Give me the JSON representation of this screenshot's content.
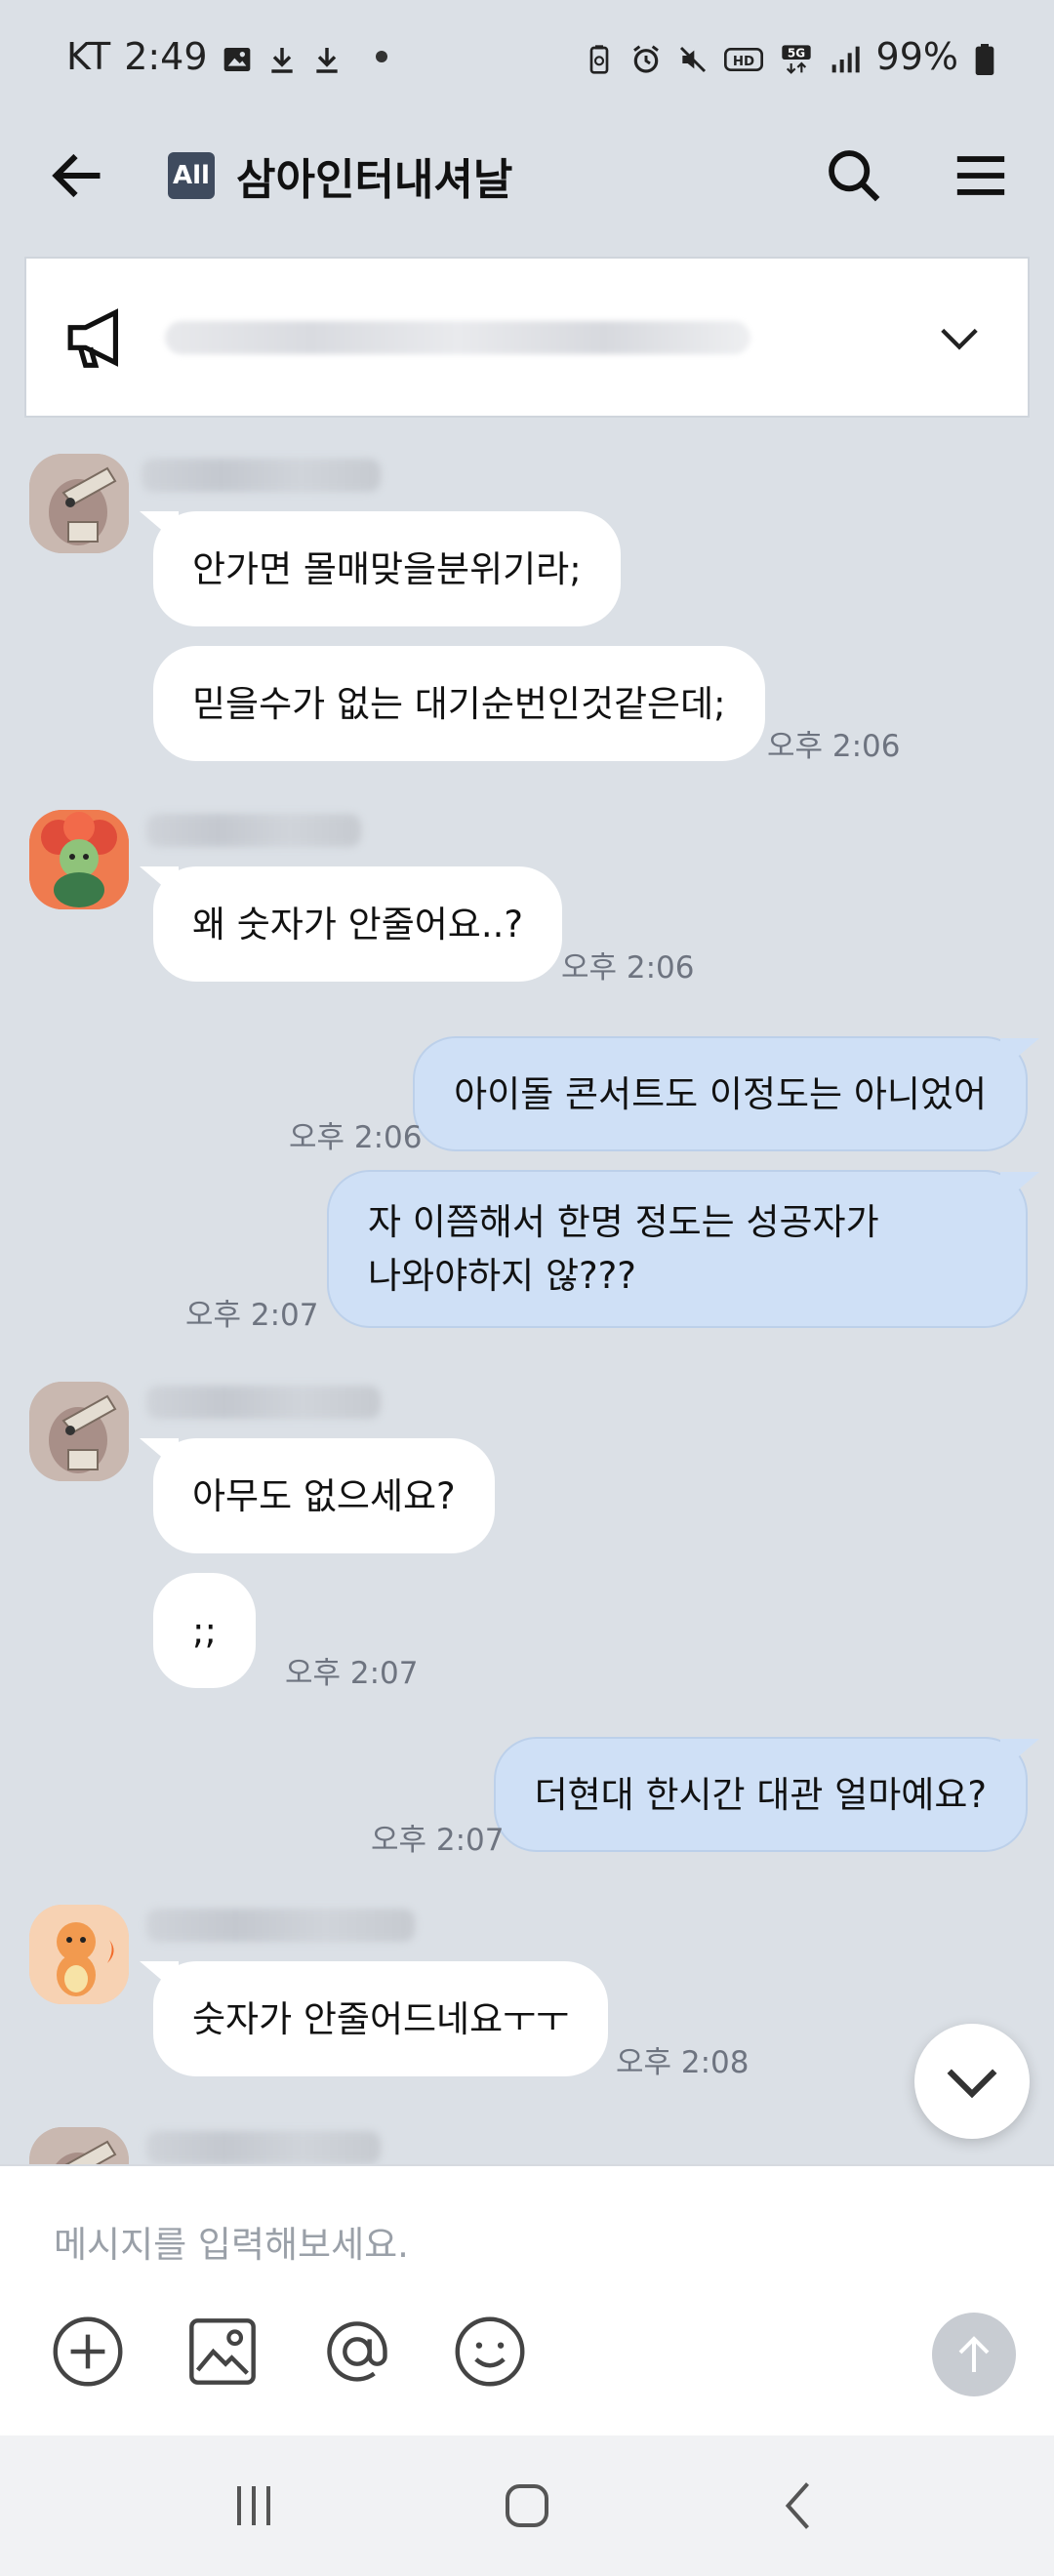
{
  "status_bar": {
    "carrier": "KT",
    "time": "2:49",
    "network": "5G",
    "battery": "99%"
  },
  "header": {
    "badge": "All",
    "title": "삼아인터내셔날"
  },
  "notice": {
    "icon": "megaphone-icon"
  },
  "messages": [
    {
      "text": "안가면 몰매맞을분위기라;"
    },
    {
      "text": "믿을수가 없는 대기순번인것같은데;",
      "time": "오후 2:06"
    },
    {
      "text": "왜 숫자가 안줄어요..?",
      "time": "오후 2:06"
    },
    {
      "text": "아이돌 콘서트도 이정도는 아니었어",
      "time": "오후 2:06"
    },
    {
      "line1": "자 이쯤해서 한명 정도는 성공자가",
      "line2": "나와야하지 않???",
      "time": "오후 2:07"
    },
    {
      "text": "아무도 없으세요?"
    },
    {
      "text": ";;",
      "time": "오후 2:07"
    },
    {
      "text": "더현대 한시간 대관 얼마예요?",
      "time": "오후 2:07"
    },
    {
      "text": "숫자가 안줄어드네요ㅜㅜ",
      "time": "오후 2:08"
    }
  ],
  "input": {
    "placeholder": "메시지를 입력해보세요."
  },
  "colors": {
    "background": "#dbe0e6",
    "my_bubble": "#cfe0f6",
    "other_bubble": "#ffffff",
    "badge": "#3f4b5e"
  }
}
